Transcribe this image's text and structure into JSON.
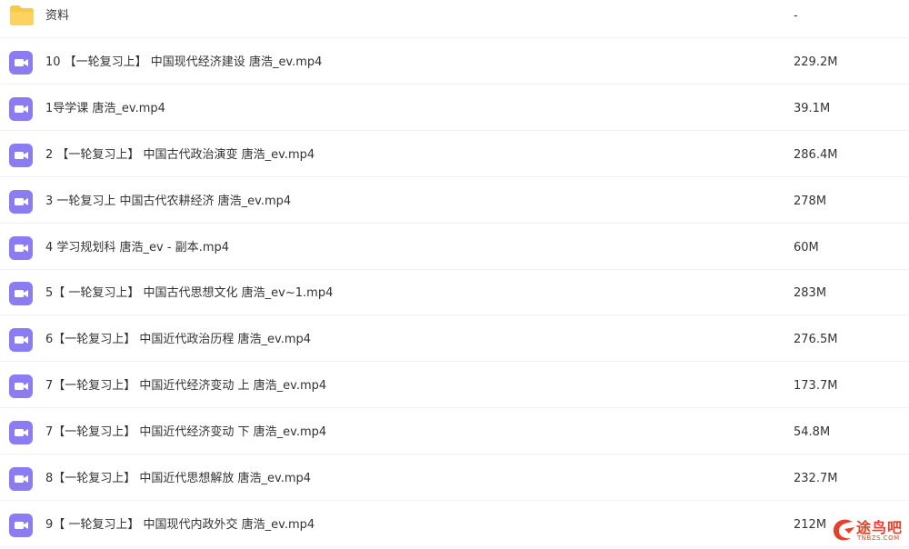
{
  "colors": {
    "folder": "#f7c948",
    "video": "#8c7cf2",
    "watermark": "#e5412a"
  },
  "files": [
    {
      "name": "资料",
      "size": "-",
      "icon": "folder-icon"
    },
    {
      "name": "10 【一轮复习上】 中国现代经济建设 唐浩_ev.mp4",
      "size": "229.2M",
      "icon": "video-file-icon"
    },
    {
      "name": "1导学课 唐浩_ev.mp4",
      "size": "39.1M",
      "icon": "video-file-icon"
    },
    {
      "name": "2 【一轮复习上】 中国古代政治演变 唐浩_ev.mp4",
      "size": "286.4M",
      "icon": "video-file-icon"
    },
    {
      "name": "3 一轮复习上 中国古代农耕经济 唐浩_ev.mp4",
      "size": "278M",
      "icon": "video-file-icon"
    },
    {
      "name": "4 学习规划科 唐浩_ev - 副本.mp4",
      "size": "60M",
      "icon": "video-file-icon"
    },
    {
      "name": "5【 一轮复习上】 中国古代思想文化 唐浩_ev~1.mp4",
      "size": "283M",
      "icon": "video-file-icon"
    },
    {
      "name": "6【一轮复习上】 中国近代政治历程 唐浩_ev.mp4",
      "size": "276.5M",
      "icon": "video-file-icon"
    },
    {
      "name": "7【一轮复习上】 中国近代经济变动 上 唐浩_ev.mp4",
      "size": "173.7M",
      "icon": "video-file-icon"
    },
    {
      "name": "7【一轮复习上】 中国近代经济变动 下 唐浩_ev.mp4",
      "size": "54.8M",
      "icon": "video-file-icon"
    },
    {
      "name": "8【一轮复习上】 中国近代思想解放 唐浩_ev.mp4",
      "size": "232.7M",
      "icon": "video-file-icon"
    },
    {
      "name": "9【 一轮复习上】 中国现代内政外交 唐浩_ev.mp4",
      "size": "212M",
      "icon": "video-file-icon"
    }
  ],
  "watermark": {
    "text": "途鸟吧",
    "subtext": "TNBZS.COM"
  }
}
